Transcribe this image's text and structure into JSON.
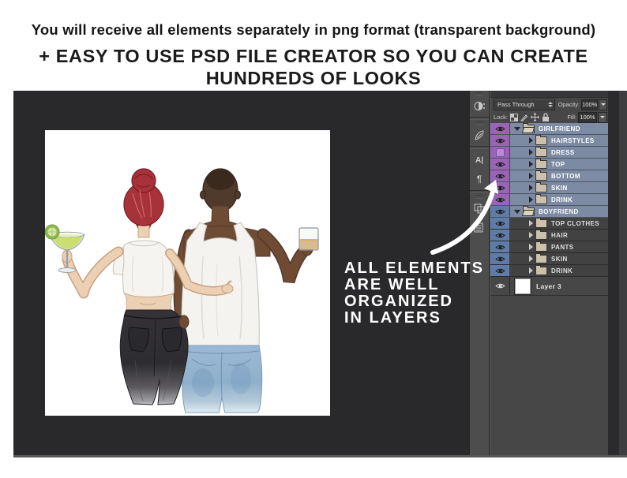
{
  "header": {
    "line1": "You will receive all elements separately in png format (transparent background)",
    "line2": "+ EASY TO USE PSD FILE CREATOR SO YOU CAN CREATE",
    "line3": "HUNDREDS OF LOOKS"
  },
  "annotation": {
    "line1": "ALL ELEMENTS",
    "line2": "ARE WELL",
    "line3": "ORGANIZED",
    "line4": "IN LAYERS"
  },
  "layers_panel": {
    "blend_mode": "Pass Through",
    "opacity_label": "Opacity:",
    "opacity_value": "100%",
    "lock_label": "Lock:",
    "fill_label": "Fill:",
    "fill_value": "100%",
    "layers": [
      {
        "name": "GIRLFRIEND",
        "type": "group",
        "expanded": true,
        "visible": true,
        "selected": true,
        "label_color": "#9a64b6"
      },
      {
        "name": "HAIRSTYLES",
        "type": "group",
        "expanded": false,
        "visible": true,
        "selected": true,
        "label_color": "#9a64b6"
      },
      {
        "name": "DRESS",
        "type": "group",
        "expanded": false,
        "visible": false,
        "selected": true,
        "label_color": "#9a64b6"
      },
      {
        "name": "TOP",
        "type": "group",
        "expanded": false,
        "visible": true,
        "selected": true,
        "label_color": "#9a64b6"
      },
      {
        "name": "BOTTOM",
        "type": "group",
        "expanded": false,
        "visible": true,
        "selected": true,
        "label_color": "#9a64b6"
      },
      {
        "name": "SKIN",
        "type": "group",
        "expanded": false,
        "visible": true,
        "selected": true,
        "label_color": "#9a64b6"
      },
      {
        "name": "DRINK",
        "type": "group",
        "expanded": false,
        "visible": true,
        "selected": true,
        "label_color": "#9a64b6"
      },
      {
        "name": "BOYFRIEND",
        "type": "group",
        "expanded": true,
        "visible": true,
        "selected": true,
        "label_color": "#5f7ca8"
      },
      {
        "name": "TOP CLOTHES",
        "type": "group",
        "expanded": false,
        "visible": true,
        "selected": false,
        "label_color": "#5f7ca8"
      },
      {
        "name": "HAIR",
        "type": "group",
        "expanded": false,
        "visible": true,
        "selected": false,
        "label_color": "#5f7ca8"
      },
      {
        "name": "PANTS",
        "type": "group",
        "expanded": false,
        "visible": true,
        "selected": false,
        "label_color": "#5f7ca8"
      },
      {
        "name": "SKIN",
        "type": "group",
        "expanded": false,
        "visible": true,
        "selected": false,
        "label_color": "#5f7ca8"
      },
      {
        "name": "DRINK",
        "type": "group",
        "expanded": false,
        "visible": true,
        "selected": false,
        "label_color": "#5f7ca8"
      },
      {
        "name": "Layer 3",
        "type": "layer",
        "expanded": false,
        "visible": true,
        "selected": false,
        "label_color": null
      }
    ]
  },
  "dock": {
    "character_glyph": "A|",
    "paragraph_glyph": "¶"
  },
  "colors": {
    "workspace_bg": "#29292b",
    "panel_bg": "#474747",
    "selected_row": "#7c8aa3",
    "girlfriend_label": "#9a64b6",
    "boyfriend_label": "#5f7ca8",
    "arrow": "#ffffff"
  }
}
